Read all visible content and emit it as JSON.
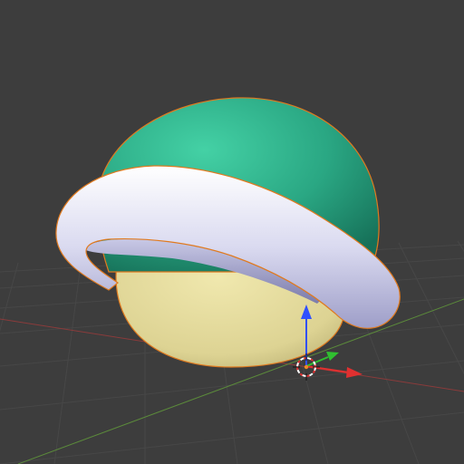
{
  "viewport": {
    "background": "#3d3d3d",
    "grid_color": "#474747",
    "x_axis_color": "#8a3b3b",
    "y_axis_color": "#5b8a3b"
  },
  "object": {
    "name_icon": "shell-object",
    "selected": true,
    "selection_outline_color": "#e07a1f",
    "shell_color": "#2db38d",
    "rim_color": "#d9d9ee",
    "underside_color": "#e4dd99"
  },
  "gizmo": {
    "icon": "translate-gizmo",
    "x_arrow_color": "#e03030",
    "y_arrow_color": "#30c030",
    "z_arrow_color": "#3050ff",
    "cursor_icon": "3d-cursor-icon"
  }
}
